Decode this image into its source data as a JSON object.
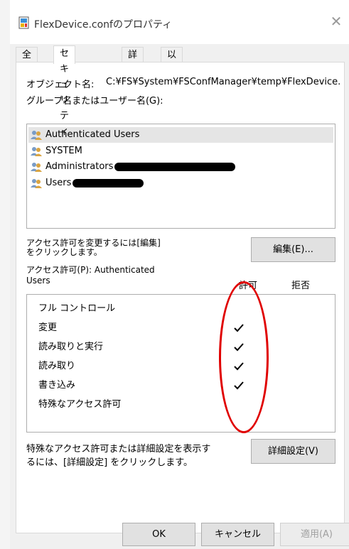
{
  "window": {
    "title": "FlexDevice.confのプロパティ",
    "close_glyph": "✕"
  },
  "tabs": [
    {
      "label": "全般"
    },
    {
      "label": "セキュリティ"
    },
    {
      "label": "詳細"
    },
    {
      "label": "以前のバージョン"
    }
  ],
  "active_tab": "セキュリティ",
  "object": {
    "label": "オブジェクト名:",
    "value": "C:¥FS¥System¥FSConfManager¥temp¥FlexDevice."
  },
  "groups": {
    "label": "グループ名またはユーザー名(G):",
    "items": [
      {
        "name": "Authenticated Users",
        "selected": true
      },
      {
        "name": "SYSTEM"
      },
      {
        "name": "Administrators",
        "redacted": true
      },
      {
        "name": "Users",
        "redacted": true
      }
    ]
  },
  "change": {
    "text_line1": "アクセス許可を変更するには[編集]",
    "text_line2": "をクリックします。",
    "button": "編集(E)..."
  },
  "permissions": {
    "label_line1": "アクセス許可(P): Authenticated",
    "label_line2": "Users",
    "allow_header": "許可",
    "deny_header": "拒否",
    "rows": [
      {
        "name": "フル コントロール",
        "allow": false
      },
      {
        "name": "変更",
        "allow": true
      },
      {
        "name": "読み取りと実行",
        "allow": true
      },
      {
        "name": "読み取り",
        "allow": true
      },
      {
        "name": "書き込み",
        "allow": true
      },
      {
        "name": "特殊なアクセス許可",
        "allow": false
      }
    ]
  },
  "advanced": {
    "text_line1": "特殊なアクセス許可または詳細設定を表示す",
    "text_line2": "るには、[詳細設定] をクリックします。",
    "button": "詳細設定(V)"
  },
  "footer": {
    "ok": "OK",
    "cancel": "キャンセル",
    "apply": "適用(A)"
  },
  "colors": {
    "annotation": "#e00000",
    "selection": "#e5e5e5"
  },
  "icons": {
    "title": "document-icon",
    "user": "users-group-icon",
    "check": "checkmark-icon"
  }
}
